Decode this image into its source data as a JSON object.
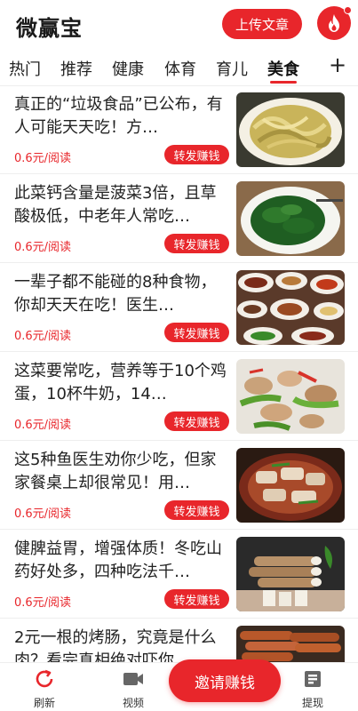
{
  "header": {
    "app_title": "微赢宝",
    "upload_label": "上传文章"
  },
  "tabs": [
    {
      "label": "热门"
    },
    {
      "label": "推荐"
    },
    {
      "label": "健康"
    },
    {
      "label": "体育"
    },
    {
      "label": "育儿"
    },
    {
      "label": "美食"
    }
  ],
  "active_tab": "美食",
  "articles": [
    {
      "title": "真正的“垃圾食品”已公布，有人可能天天吃！方…",
      "price": "0.6元/阅读",
      "share_label": "转发赚钱"
    },
    {
      "title": "此菜钙含量是菠菜3倍，且草酸极低，中老年人常吃…",
      "price": "0.6元/阅读",
      "share_label": "转发赚钱"
    },
    {
      "title": "一辈子都不能碰的8种食物，你却天天在吃！医生…",
      "price": "0.6元/阅读",
      "share_label": "转发赚钱"
    },
    {
      "title": "这菜要常吃，营养等于10个鸡蛋，10杯牛奶，14…",
      "price": "0.6元/阅读",
      "share_label": "转发赚钱"
    },
    {
      "title": "这5种鱼医生劝你少吃，但家家餐桌上却很常见！用…",
      "price": "0.6元/阅读",
      "share_label": "转发赚钱"
    },
    {
      "title": "健脾益胃，增强体质！冬吃山药好处多，四种吃法千…",
      "price": "0.6元/阅读",
      "share_label": "转发赚钱"
    },
    {
      "title": "2元一根的烤肠，究竟是什么肉？看完真相绝对吓你…",
      "price": "",
      "share_label": ""
    }
  ],
  "bottom_nav": {
    "refresh_label": "刷新",
    "video_label": "视频",
    "invite_label": "邀请赚钱",
    "withdraw_label": "提现"
  },
  "colors": {
    "accent": "#e8262b"
  }
}
